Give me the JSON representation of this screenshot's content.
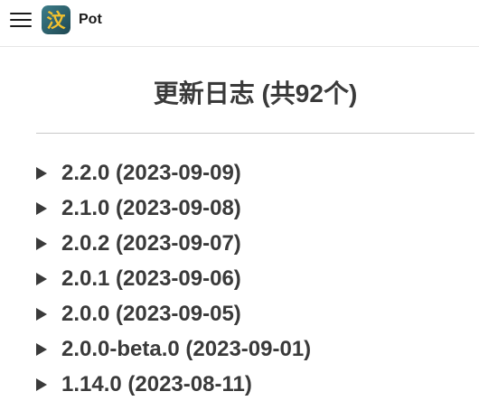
{
  "app": {
    "title": "Pot",
    "logo_icon": "pot-translate-logo-icon",
    "logo_glyph": "汶"
  },
  "page": {
    "heading": "更新日志 (共92个)"
  },
  "releases": [
    {
      "label": "2.2.0 (2023-09-09)"
    },
    {
      "label": "2.1.0 (2023-09-08)"
    },
    {
      "label": "2.0.2 (2023-09-07)"
    },
    {
      "label": "2.0.1 (2023-09-06)"
    },
    {
      "label": "2.0.0 (2023-09-05)"
    },
    {
      "label": "2.0.0-beta.0 (2023-09-01)"
    },
    {
      "label": "1.14.0 (2023-08-11)"
    }
  ],
  "colors": {
    "text": "#3a3a3a",
    "logo_bg": "#2b5c6b",
    "logo_glyph": "#f2c12e"
  }
}
